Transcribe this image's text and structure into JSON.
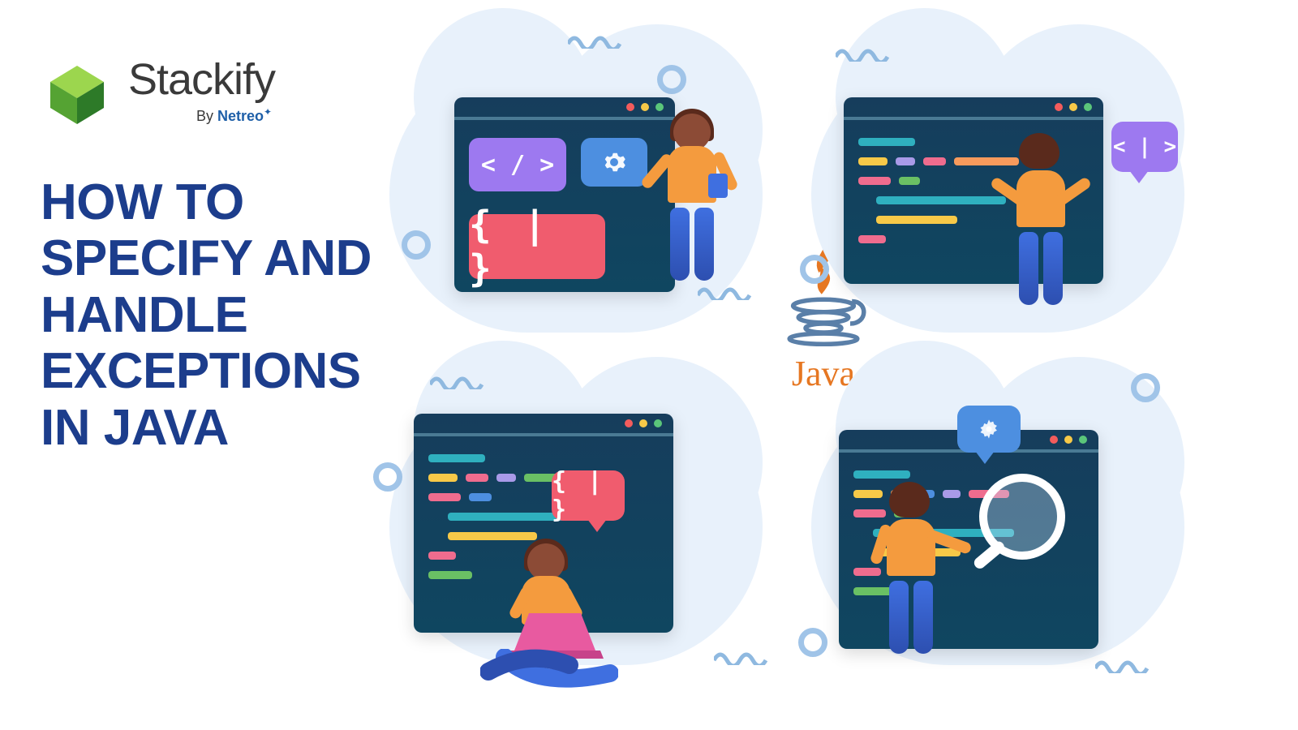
{
  "brand": {
    "name": "Stackify",
    "byline_prefix": "By ",
    "byline_brand": "Netreo"
  },
  "title": "HOW TO SPECIFY AND HANDLE EXCEPTIONS IN JAVA",
  "java_label": "Java",
  "bubbles": {
    "top_right": "< | >",
    "bottom_left": "{ | }"
  },
  "pills": {
    "code_tag": "< / >",
    "braces": "{ | }"
  },
  "icons": {
    "gear": "gear-icon",
    "magnifier": "magnifier-icon"
  }
}
